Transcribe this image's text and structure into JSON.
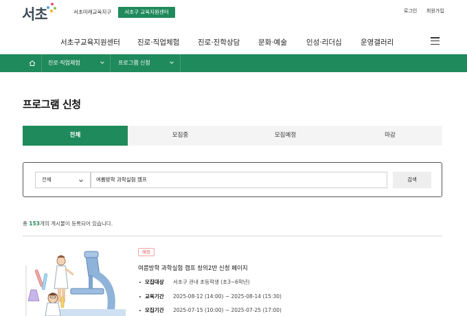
{
  "header": {
    "logo_text": "서초",
    "site_link": "서초미래교육지구",
    "center_button": "서초구 교육지원센터",
    "login": "로그인",
    "signup": "회원가입"
  },
  "nav": {
    "items": [
      "서초구교육지원센터",
      "진로·직업체험",
      "진로·진학상담",
      "문화·예술",
      "인성·리더십",
      "운영갤러리"
    ]
  },
  "breadcrumb": {
    "level1": "진로·직업체험",
    "level2": "프로그램 신청"
  },
  "page": {
    "title": "프로그램 신청"
  },
  "tabs": [
    "전체",
    "모집중",
    "모집예정",
    "마감"
  ],
  "search": {
    "select_value": "전체",
    "query_value": "여름방학 과학실험 캠프",
    "button_label": "검색"
  },
  "summary": {
    "prefix": "총 ",
    "count": "153",
    "suffix": "개의 게시물이 등록되어 있습니다."
  },
  "post": {
    "badge": "예정",
    "title": "여름방학 과학실험 캠프 창의2반 신청 페이지",
    "meta": [
      {
        "label": "모집대상",
        "value": "서초구 관내 초등학생 (초3~6학년)"
      },
      {
        "label": "교육기간",
        "value": "2025-08-12 (14:00) ~ 2025-08-14 (15:30)"
      },
      {
        "label": "모집기간",
        "value": "2025-07-15 (10:00) ~ 2025-07-25 (17:00)"
      }
    ]
  },
  "colors": {
    "accent": "#1f8a5b",
    "badge": "#e05a5a"
  }
}
